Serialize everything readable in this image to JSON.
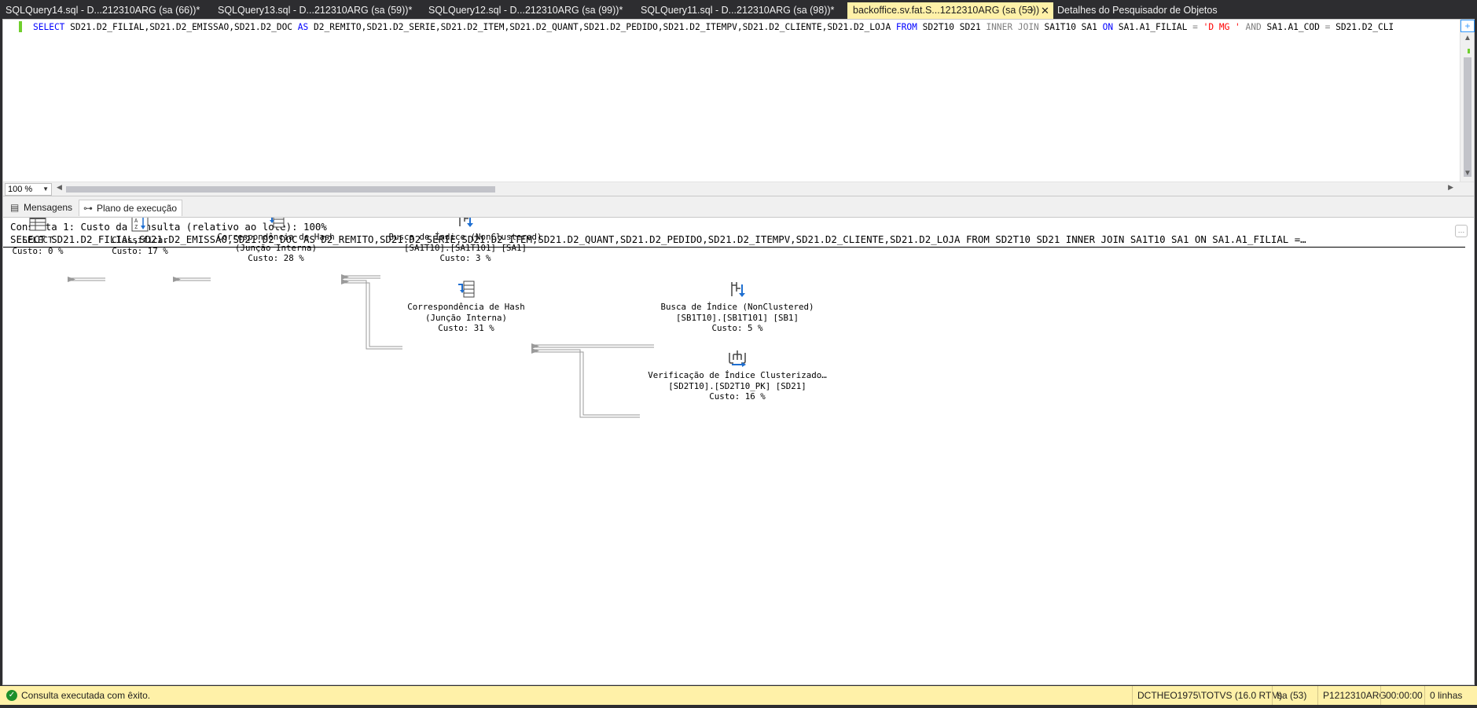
{
  "tabs": [
    {
      "label": "SQLQuery14.sql - D...212310ARG (sa (66))*",
      "active": false
    },
    {
      "label": "SQLQuery13.sql - D...212310ARG (sa (59))*",
      "active": false
    },
    {
      "label": "SQLQuery12.sql - D...212310ARG (sa (99))*",
      "active": false
    },
    {
      "label": "SQLQuery11.sql - D...212310ARG (sa (98))*",
      "active": false
    },
    {
      "label": "backoffice.sv.fat.S...1212310ARG (sa (53))",
      "active": true
    },
    {
      "label": "Detalhes do Pesquisador de Objetos",
      "active": false
    }
  ],
  "editor": {
    "sql_parts": [
      {
        "text": "SELECT",
        "cls": "kw"
      },
      {
        "text": " SD21.D2_FILIAL,SD21.D2_EMISSAO,SD21.D2_DOC ",
        "cls": ""
      },
      {
        "text": "AS",
        "cls": "kw"
      },
      {
        "text": " D2_REMITO,SD21.D2_SERIE,SD21.D2_ITEM,SD21.D2_QUANT,SD21.D2_PEDIDO,SD21.D2_ITEMPV,SD21.D2_CLIENTE,SD21.D2_LOJA ",
        "cls": ""
      },
      {
        "text": "FROM",
        "cls": "kw"
      },
      {
        "text": " SD2T10 SD21 ",
        "cls": ""
      },
      {
        "text": "INNER JOIN",
        "cls": "kw2"
      },
      {
        "text": " SA1T10 SA1 ",
        "cls": ""
      },
      {
        "text": "ON",
        "cls": "kw"
      },
      {
        "text": " SA1.A1_FILIAL ",
        "cls": ""
      },
      {
        "text": "=",
        "cls": "kw2"
      },
      {
        "text": " 'D MG    '",
        "cls": "str"
      },
      {
        "text": " ",
        "cls": ""
      },
      {
        "text": "AND",
        "cls": "kw2"
      },
      {
        "text": " SA1.A1_COD ",
        "cls": ""
      },
      {
        "text": "=",
        "cls": "kw2"
      },
      {
        "text": " SD21.D2_CLI",
        "cls": ""
      }
    ],
    "zoom": "100 %"
  },
  "result_tabs": {
    "messages": "Mensagens",
    "plan": "Plano de execução"
  },
  "plan": {
    "header": "Consulta 1: Custo da consulta (relativo ao lote): 100%",
    "query": "SELECT SD21.D2_FILIAL,SD21.D2_EMISSAO,SD21.D2_DOC AS D2_REMITO,SD21.D2_SERIE,SD21.D2_ITEM,SD21.D2_QUANT,SD21.D2_PEDIDO,SD21.D2_ITEMPV,SD21.D2_CLIENTE,SD21.D2_LOJA FROM SD2T10 SD21 INNER JOIN SA1T10 SA1 ON SA1.A1_FILIAL =…",
    "nodes": [
      {
        "id": "select",
        "icon": "select-icon",
        "lines": [
          "SELECT",
          "Custo: 0 %"
        ]
      },
      {
        "id": "sort",
        "icon": "sort-icon",
        "lines": [
          "Classificar",
          "Custo: 17 %"
        ]
      },
      {
        "id": "hash1",
        "icon": "hash-match-icon",
        "lines": [
          "Correspondência de Hash",
          "(Junção Interna)",
          "Custo: 28 %"
        ]
      },
      {
        "id": "seek1",
        "icon": "index-seek-icon",
        "lines": [
          "Busca de Índice (NonClustered)",
          "[SA1T10].[SA1T101] [SA1]",
          "Custo: 3 %"
        ]
      },
      {
        "id": "hash2",
        "icon": "hash-match-icon",
        "lines": [
          "Correspondência de Hash",
          "(Junção Interna)",
          "Custo: 31 %"
        ]
      },
      {
        "id": "seek2",
        "icon": "index-seek-icon",
        "lines": [
          "Busca de Índice (NonClustered)",
          "[SB1T10].[SB1T101] [SB1]",
          "Custo: 5 %"
        ]
      },
      {
        "id": "scan",
        "icon": "clustered-index-scan-icon",
        "lines": [
          "Verificação de Índice Clusterizado…",
          "[SD2T10].[SD2T10_PK] [SD21]",
          "Custo: 16 %"
        ]
      }
    ]
  },
  "status": {
    "message": "Consulta executada com êxito.",
    "server": "DCTHEO1975\\TOTVS (16.0 RTM)",
    "user": "sa (53)",
    "database": "P1212310ARG",
    "elapsed": "00:00:00",
    "rows": "0 linhas"
  },
  "colors": {
    "active_tab": "#fff1a8",
    "status_bar": "#fff1a8",
    "keyword": "#0000ff",
    "string": "#ff0000"
  }
}
